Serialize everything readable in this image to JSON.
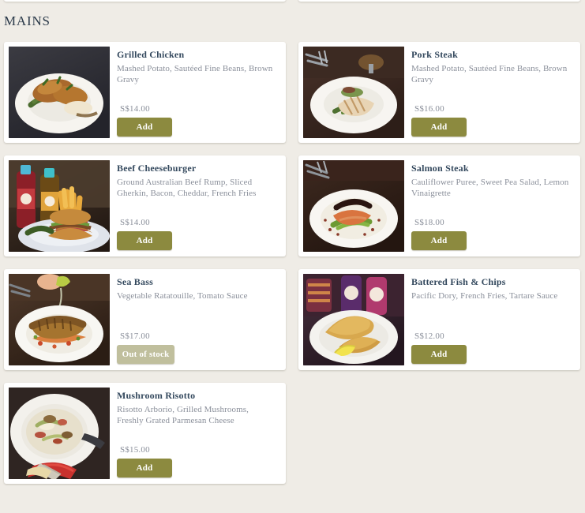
{
  "section": {
    "title": "MAINS",
    "currency_prefix": "S$",
    "accent_color": "#8c8a3f",
    "disabled_color": "#c0bf9d",
    "page_background": "#efece6",
    "card_background": "#ffffff",
    "title_color": "#2b3a4a"
  },
  "labels": {
    "add": "Add",
    "out_of_stock": "Out of stock"
  },
  "items": [
    {
      "name": "Grilled Chicken",
      "description": "Mashed Potato, Sautéed Fine Beans, Brown Gravy",
      "price": "S$14.00",
      "action": "Add",
      "available": true,
      "image_name": "grilled-chicken-photo"
    },
    {
      "name": "Pork Steak",
      "description": "Mashed Potato, Sautéed Fine Beans, Brown Gravy",
      "price": "S$16.00",
      "action": "Add",
      "available": true,
      "image_name": "pork-steak-photo"
    },
    {
      "name": "Beef Cheeseburger",
      "description": "Ground Australian Beef Rump, Sliced Gherkin, Bacon, Cheddar, French Fries",
      "price": "S$14.00",
      "action": "Add",
      "available": true,
      "image_name": "beef-cheeseburger-photo"
    },
    {
      "name": "Salmon Steak",
      "description": "Cauliflower Puree, Sweet Pea Salad, Lemon Vinaigrette",
      "price": "S$18.00",
      "action": "Add",
      "available": true,
      "image_name": "salmon-steak-photo"
    },
    {
      "name": "Sea Bass",
      "description": "Vegetable Ratatouille, Tomato Sauce",
      "price": "S$17.00",
      "action": "Out of stock",
      "available": false,
      "image_name": "sea-bass-photo"
    },
    {
      "name": "Battered Fish & Chips",
      "description": "Pacific Dory, French Fries, Tartare Sauce",
      "price": "S$12.00",
      "action": "Add",
      "available": true,
      "image_name": "battered-fish-and-chips-photo"
    },
    {
      "name": "Mushroom Risotto",
      "description": "Risotto Arborio, Grilled Mushrooms, Freshly Grated Parmesan Cheese",
      "price": "S$15.00",
      "action": "Add",
      "available": true,
      "image_name": "mushroom-risotto-photo"
    }
  ]
}
